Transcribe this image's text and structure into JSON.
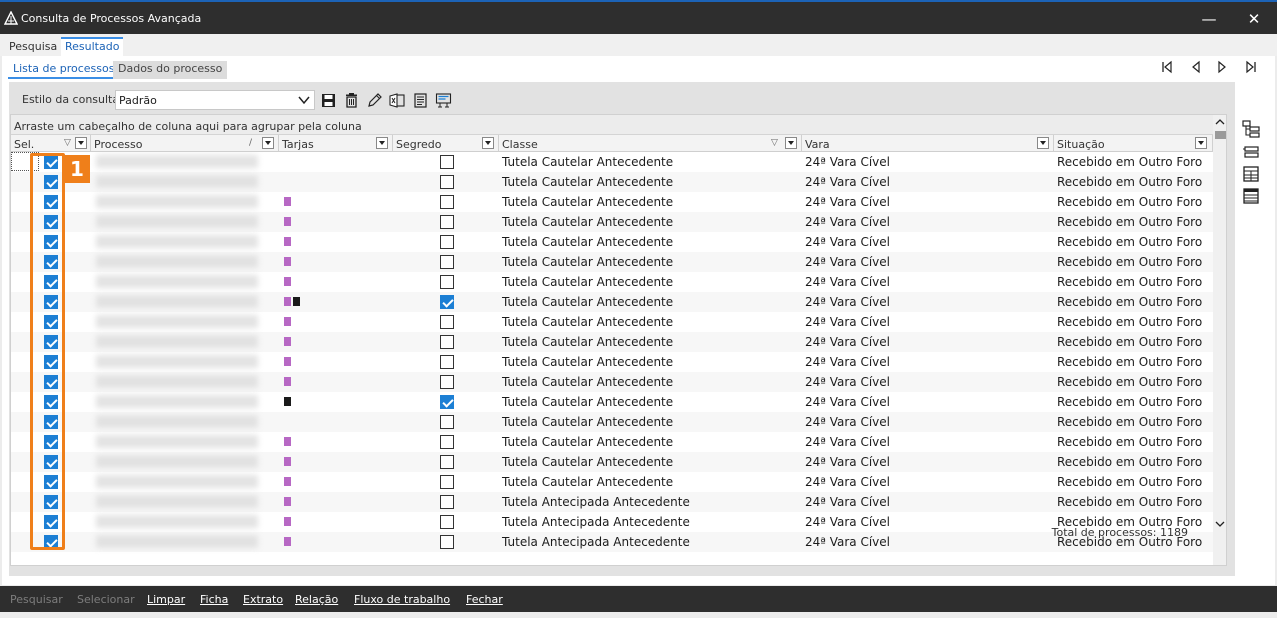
{
  "window": {
    "title": "Consulta de Processos Avançada",
    "minimize": "—",
    "close": "✕"
  },
  "outer_tabs": [
    "Pesquisa",
    "Resultado"
  ],
  "inner_tabs": [
    "Lista de processos",
    "Dados do processo"
  ],
  "toolbar": {
    "style_label": "Estilo da consulta",
    "style_value": "Padrão"
  },
  "grid": {
    "group_hint": "Arraste um cabeçalho de coluna aqui para agrupar pela coluna",
    "columns": [
      "Sel.",
      "Processo",
      "Tarjas",
      "Segredo",
      "Classe",
      "Vara",
      "Situação"
    ],
    "rows": [
      {
        "sel": true,
        "tarjas": [],
        "segredo": false,
        "classe": "Tutela Cautelar Antecedente",
        "vara": "24ª Vara Cível",
        "situacao": "Recebido em Outro Foro"
      },
      {
        "sel": true,
        "tarjas": [],
        "segredo": false,
        "classe": "Tutela Cautelar Antecedente",
        "vara": "24ª Vara Cível",
        "situacao": "Recebido em Outro Foro"
      },
      {
        "sel": true,
        "tarjas": [
          "purple"
        ],
        "segredo": false,
        "classe": "Tutela Cautelar Antecedente",
        "vara": "24ª Vara Cível",
        "situacao": "Recebido em Outro Foro"
      },
      {
        "sel": true,
        "tarjas": [
          "purple"
        ],
        "segredo": false,
        "classe": "Tutela Cautelar Antecedente",
        "vara": "24ª Vara Cível",
        "situacao": "Recebido em Outro Foro"
      },
      {
        "sel": true,
        "tarjas": [
          "purple"
        ],
        "segredo": false,
        "classe": "Tutela Cautelar Antecedente",
        "vara": "24ª Vara Cível",
        "situacao": "Recebido em Outro Foro"
      },
      {
        "sel": true,
        "tarjas": [
          "purple"
        ],
        "segredo": false,
        "classe": "Tutela Cautelar Antecedente",
        "vara": "24ª Vara Cível",
        "situacao": "Recebido em Outro Foro"
      },
      {
        "sel": true,
        "tarjas": [
          "purple"
        ],
        "segredo": false,
        "classe": "Tutela Cautelar Antecedente",
        "vara": "24ª Vara Cível",
        "situacao": "Recebido em Outro Foro"
      },
      {
        "sel": true,
        "tarjas": [
          "purple",
          "black"
        ],
        "segredo": true,
        "classe": "Tutela Cautelar Antecedente",
        "vara": "24ª Vara Cível",
        "situacao": "Recebido em Outro Foro"
      },
      {
        "sel": true,
        "tarjas": [
          "purple"
        ],
        "segredo": false,
        "classe": "Tutela Cautelar Antecedente",
        "vara": "24ª Vara Cível",
        "situacao": "Recebido em Outro Foro"
      },
      {
        "sel": true,
        "tarjas": [
          "purple"
        ],
        "segredo": false,
        "classe": "Tutela Cautelar Antecedente",
        "vara": "24ª Vara Cível",
        "situacao": "Recebido em Outro Foro"
      },
      {
        "sel": true,
        "tarjas": [
          "purple"
        ],
        "segredo": false,
        "classe": "Tutela Cautelar Antecedente",
        "vara": "24ª Vara Cível",
        "situacao": "Recebido em Outro Foro"
      },
      {
        "sel": true,
        "tarjas": [
          "purple"
        ],
        "segredo": false,
        "classe": "Tutela Cautelar Antecedente",
        "vara": "24ª Vara Cível",
        "situacao": "Recebido em Outro Foro"
      },
      {
        "sel": true,
        "tarjas": [
          "black"
        ],
        "segredo": true,
        "classe": "Tutela Cautelar Antecedente",
        "vara": "24ª Vara Cível",
        "situacao": "Recebido em Outro Foro"
      },
      {
        "sel": true,
        "tarjas": [],
        "segredo": false,
        "classe": "Tutela Cautelar Antecedente",
        "vara": "24ª Vara Cível",
        "situacao": "Recebido em Outro Foro"
      },
      {
        "sel": true,
        "tarjas": [
          "purple"
        ],
        "segredo": false,
        "classe": "Tutela Cautelar Antecedente",
        "vara": "24ª Vara Cível",
        "situacao": "Recebido em Outro Foro"
      },
      {
        "sel": true,
        "tarjas": [
          "purple"
        ],
        "segredo": false,
        "classe": "Tutela Cautelar Antecedente",
        "vara": "24ª Vara Cível",
        "situacao": "Recebido em Outro Foro"
      },
      {
        "sel": true,
        "tarjas": [
          "purple"
        ],
        "segredo": false,
        "classe": "Tutela Cautelar Antecedente",
        "vara": "24ª Vara Cível",
        "situacao": "Recebido em Outro Foro"
      },
      {
        "sel": true,
        "tarjas": [
          "purple"
        ],
        "segredo": false,
        "classe": "Tutela Antecipada Antecedente",
        "vara": "24ª Vara Cível",
        "situacao": "Recebido em Outro Foro"
      },
      {
        "sel": true,
        "tarjas": [
          "purple"
        ],
        "segredo": false,
        "classe": "Tutela Antecipada Antecedente",
        "vara": "24ª Vara Cível",
        "situacao": "Recebido em Outro Foro"
      },
      {
        "sel": true,
        "tarjas": [
          "purple"
        ],
        "segredo": false,
        "classe": "Tutela Antecipada Antecedente",
        "vara": "24ª Vara Cível",
        "situacao": "Recebido em Outro Foro"
      }
    ]
  },
  "annotation": {
    "badge": "1"
  },
  "total_label": "Total de processos: 1189",
  "footer": [
    "Pesquisar",
    "Selecionar",
    "Limpar",
    "Ficha",
    "Extrato",
    "Relação",
    "Fluxo de trabalho",
    "Fechar"
  ],
  "colors": {
    "accent": "#1c7fd4",
    "callout": "#ef7f1a",
    "tarja_purple": "#b768c4",
    "tarja_black": "#1a1a1a"
  }
}
